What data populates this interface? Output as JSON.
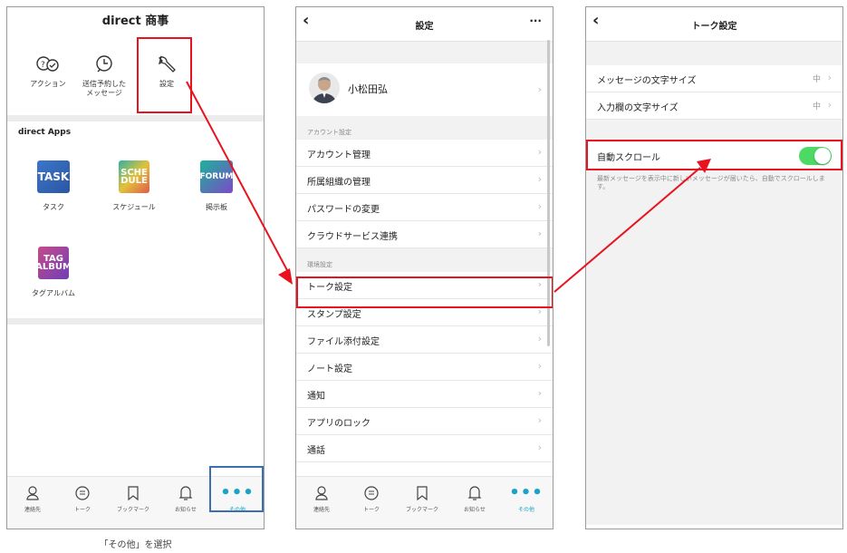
{
  "p1": {
    "title": "direct 商事",
    "quick": [
      {
        "label": "アクション",
        "icon": "action-icon"
      },
      {
        "label": "送信予約した\nメッセージ",
        "icon": "scheduled-message-icon"
      },
      {
        "label": "設定",
        "icon": "wrench-icon"
      }
    ],
    "apps_title": "direct Apps",
    "apps": [
      {
        "tile": "TASK",
        "label": "タスク"
      },
      {
        "tile": "SCHE DULE",
        "label": "スケジュール"
      },
      {
        "tile": "FORUM",
        "label": "掲示板"
      },
      {
        "tile": "TAG ALBUM",
        "label": "タグアルバム"
      }
    ]
  },
  "tabs": [
    {
      "label": "連絡先",
      "icon": "contacts-icon"
    },
    {
      "label": "トーク",
      "icon": "talk-icon"
    },
    {
      "label": "ブックマーク",
      "icon": "bookmark-icon"
    },
    {
      "label": "お知らせ",
      "icon": "bell-icon"
    },
    {
      "label": "その他",
      "icon": "more-dots-icon"
    }
  ],
  "p2": {
    "title": "設定",
    "more": "···",
    "profile_name": "小松田弘",
    "account_header": "アカウント設定",
    "account_rows": [
      "アカウント管理",
      "所属組織の管理",
      "パスワードの変更",
      "クラウドサービス連携"
    ],
    "env_header": "環境設定",
    "env_rows": [
      "トーク設定",
      "スタンプ設定",
      "ファイル添付設定",
      "ノート設定",
      "通知",
      "アプリのロック",
      "通話"
    ]
  },
  "p3": {
    "title": "トーク設定",
    "rows": [
      {
        "label": "メッセージの文字サイズ",
        "value": "中"
      },
      {
        "label": "入力欄の文字サイズ",
        "value": "中"
      }
    ],
    "auto_scroll_label": "自動スクロール",
    "auto_scroll_on": true,
    "note": "最新メッセージを表示中に新しいメッセージが届いたら、自動でスクロールします。"
  },
  "caption": "「その他」を選択",
  "colors": {
    "highlight": "#e8131e",
    "tab_highlight": "#3a6fb0",
    "accent": "#1aa3c8",
    "toggle_on": "#4cd964"
  }
}
